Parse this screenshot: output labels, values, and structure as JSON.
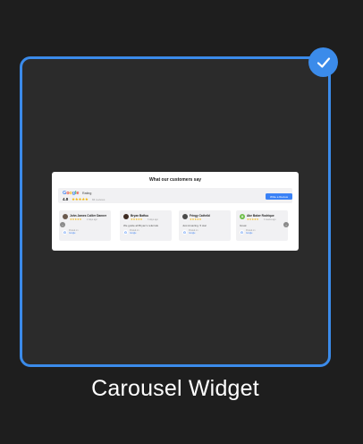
{
  "selected": true,
  "caption": "Carousel Widget",
  "colors": {
    "accent": "#3b8bea",
    "card_bg": "#2b2b2b",
    "page_bg": "#1e1e1e"
  },
  "preview": {
    "title": "What our customers say",
    "rating": {
      "brand": [
        "G",
        "o",
        "o",
        "g",
        "l",
        "e"
      ],
      "label": "Rating",
      "score": "4.8",
      "stars": "★★★★★",
      "count": "84 reviews",
      "button_label": "Write a Review"
    },
    "reviews": [
      {
        "name": "John James Collier Danner",
        "stars": "★★★★★",
        "time": "2 days ago",
        "text": "",
        "posted": "Posted on",
        "source": "Google"
      },
      {
        "name": "Bryan Batfuu",
        "stars": "★★★★★",
        "time": "3 days ago",
        "text": "We guide all Bryan's referrals",
        "posted": "Posted on",
        "source": "Google"
      },
      {
        "name": "Fringy Cathrild",
        "stars": "★★★★★",
        "time": "",
        "text": "Just Amazing. 5 star",
        "posted": "Posted on",
        "source": "Google"
      },
      {
        "name": "Abe Baker Rodrique",
        "avatar_letter": "A",
        "stars": "★★★★★",
        "time": "4 weeks ago",
        "text": "Great",
        "posted": "Posted on",
        "source": "Google"
      }
    ],
    "prev_arrow": "‹",
    "next_arrow": "›"
  }
}
